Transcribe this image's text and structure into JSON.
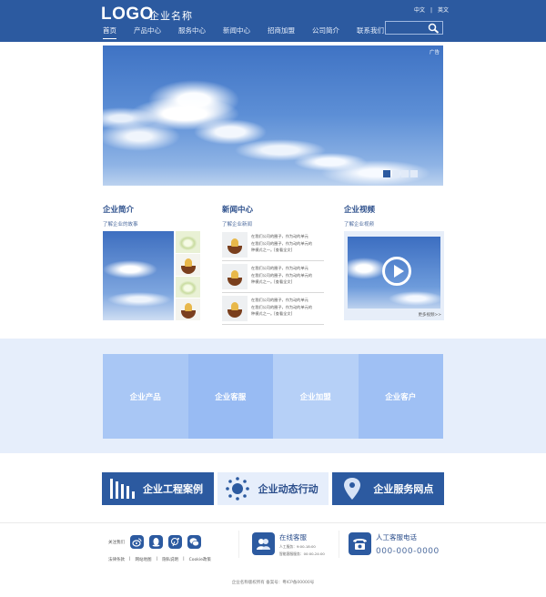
{
  "header": {
    "logo": "LOGO",
    "company_name": "企业名称",
    "languages": [
      "中文",
      "|",
      "英文"
    ],
    "nav": [
      {
        "label": "首页",
        "active": true
      },
      {
        "label": "产品中心",
        "active": false
      },
      {
        "label": "服务中心",
        "active": false
      },
      {
        "label": "新闻中心",
        "active": false
      },
      {
        "label": "招商加盟",
        "active": false
      },
      {
        "label": "公司简介",
        "active": false
      },
      {
        "label": "联系我们",
        "active": false
      }
    ],
    "search_placeholder": ""
  },
  "banner": {
    "ad_tag": "广告",
    "slide_count": 4,
    "active_slide": 1
  },
  "columns": {
    "about": {
      "title": "企业简介",
      "subtitle": "了解企业的故事"
    },
    "news": {
      "title": "新闻中心",
      "subtitle": "了解企业新闻",
      "items": [
        {
          "line1": "在我们公司的圈子，作为动的单元",
          "line2": "在我们公司的圈子，作为动的单元的",
          "line3": "种模式之一。[查看全文]"
        },
        {
          "line1": "在我们公司的圈子，作为动的单元",
          "line2": "在我们公司的圈子，作为动的单元的",
          "line3": "种模式之一。[查看全文]"
        },
        {
          "line1": "在我们公司的圈子，作为动的单元",
          "line2": "在我们公司的圈子，作为动的单元的",
          "line3": "种模式之一。[查看全文]"
        }
      ]
    },
    "video": {
      "title": "企业视频",
      "subtitle": "了解企业视频",
      "more": "更多视频>>"
    }
  },
  "tiles": [
    "企业产品",
    "企业客服",
    "企业加盟",
    "企业客户"
  ],
  "features": [
    {
      "label": "企业工程案例",
      "icon": "bar-chart-icon",
      "style": "dark"
    },
    {
      "label": "企业动态行动",
      "icon": "sun-icon",
      "style": "light"
    },
    {
      "label": "企业服务网点",
      "icon": "location-pin-icon",
      "style": "dark"
    }
  ],
  "footer": {
    "follow_label": "关注我们",
    "social": [
      "weibo-icon",
      "qq-icon",
      "tencent-weibo-icon",
      "wechat-icon"
    ],
    "links": [
      "法律条款",
      "网站地图",
      "隐私说明",
      "Cookie政策"
    ],
    "service": {
      "title": "在线客服",
      "line1": "人工服务：9:00-18:00",
      "line2": "智能客服服务：00:00-24:00"
    },
    "phone": {
      "title": "人工客服电话",
      "number": "000-000-0000"
    },
    "copyright": "企业名称版权所有 备案号：粤ICP备00000号"
  },
  "colors": {
    "primary": "#2c5aa0",
    "light_band": "#e6eefb"
  }
}
